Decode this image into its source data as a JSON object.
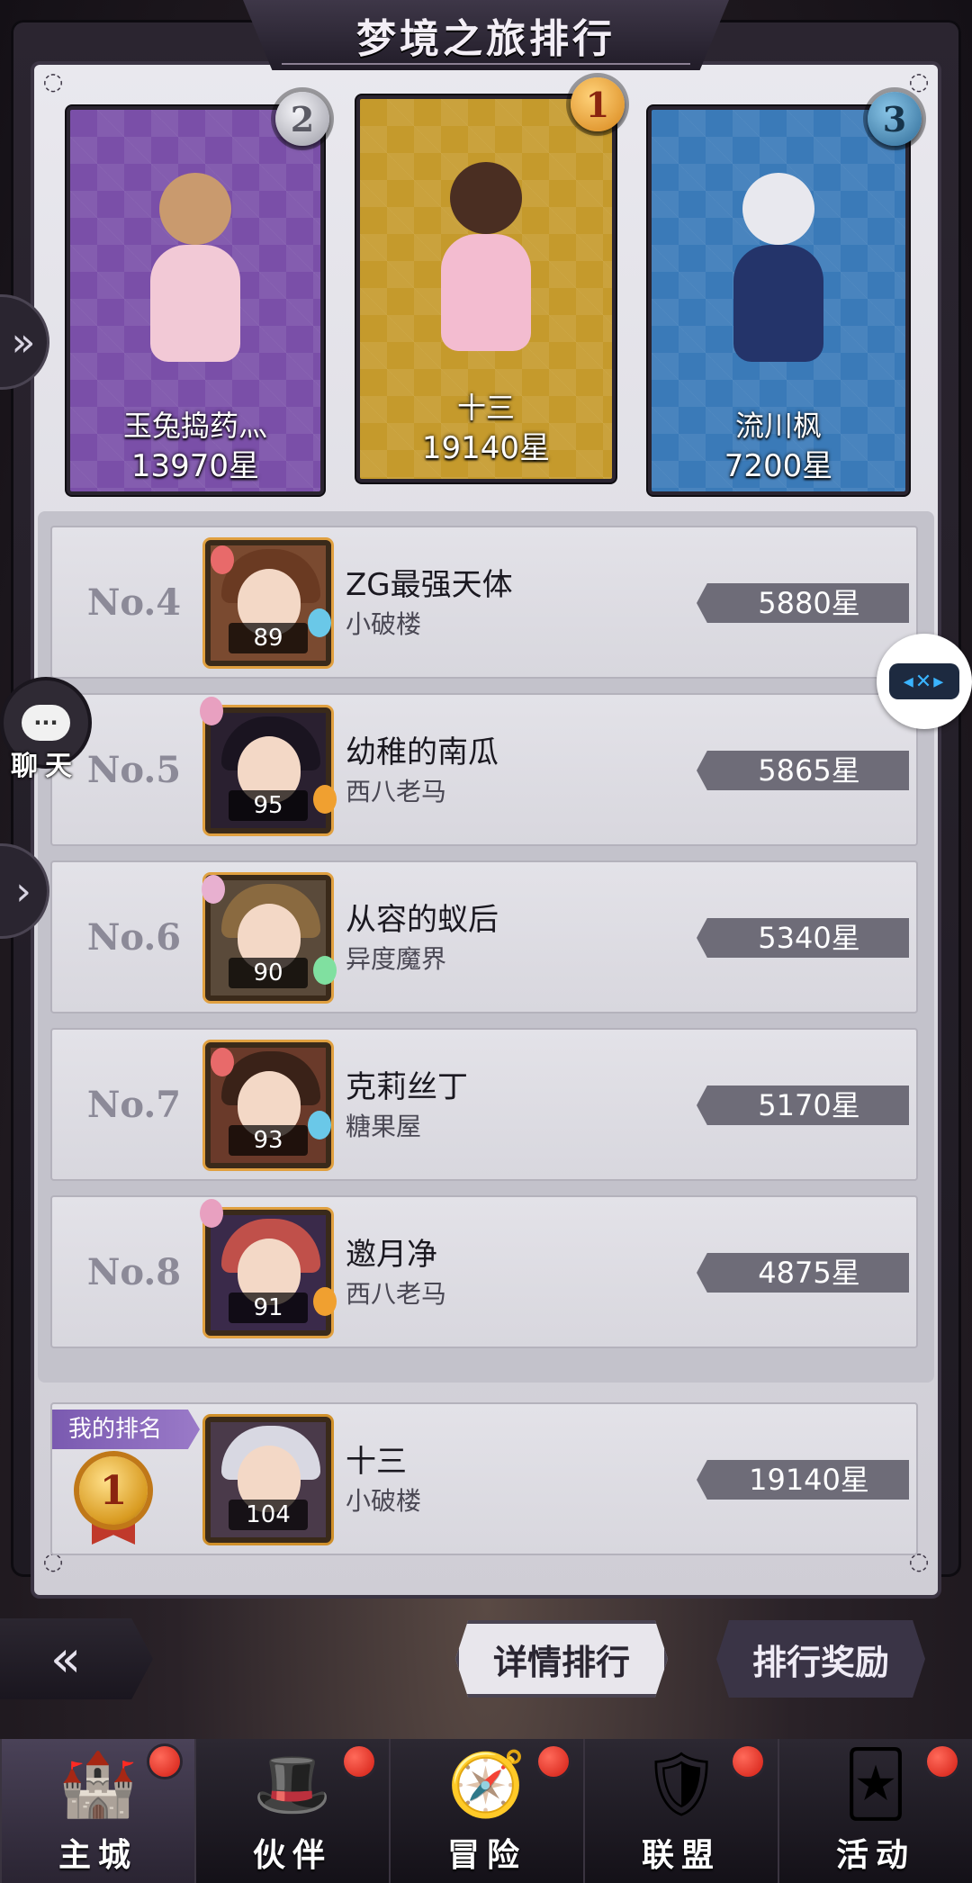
{
  "title": "梦境之旅排行",
  "podium": [
    {
      "rank": "2",
      "name": "玉兔捣药灬",
      "stars": "13970星",
      "bg": "#7a4fa8",
      "badge": "#c8c8d0"
    },
    {
      "rank": "1",
      "name": "十三",
      "stars": "19140星",
      "bg": "#c59a2c",
      "badge": "#e8a030"
    },
    {
      "rank": "3",
      "name": "流川枫",
      "stars": "7200星",
      "bg": "#3a7ab8",
      "badge": "#4a90c0"
    }
  ],
  "rankings": [
    {
      "no": "No.4",
      "level": "89",
      "name": "ZG最强天体",
      "guild": "小破楼",
      "stars": "5880星"
    },
    {
      "no": "No.5",
      "level": "95",
      "name": "幼稚的南瓜",
      "guild": "西八老马",
      "stars": "5865星"
    },
    {
      "no": "No.6",
      "level": "90",
      "name": "从容的蚁后",
      "guild": "异度魔界",
      "stars": "5340星"
    },
    {
      "no": "No.7",
      "level": "93",
      "name": "克莉丝丁",
      "guild": "糖果屋",
      "stars": "5170星"
    },
    {
      "no": "No.8",
      "level": "91",
      "name": "邀月净",
      "guild": "西八老马",
      "stars": "4875星"
    }
  ],
  "my_rank": {
    "tag": "我的排名",
    "rank": "1",
    "level": "104",
    "name": "十三",
    "guild": "小破楼",
    "stars": "19140星"
  },
  "side": {
    "chat_label": "聊天",
    "chat_icon_text": "···"
  },
  "buttons": {
    "details": "详情排行",
    "rewards": "排行奖励"
  },
  "nav": [
    {
      "label": "主城",
      "icon": "castle-icon",
      "glyph": "🏰",
      "active": true
    },
    {
      "label": "伙伴",
      "icon": "wizard-hat-icon",
      "glyph": "🎩",
      "active": false
    },
    {
      "label": "冒险",
      "icon": "compass-icon",
      "glyph": "🧭",
      "active": false
    },
    {
      "label": "联盟",
      "icon": "shield-icon",
      "glyph": "🛡",
      "active": false
    },
    {
      "label": "活动",
      "icon": "cards-icon",
      "glyph": "🃏",
      "active": false
    }
  ],
  "colors": {
    "accent_purple": "#7a5ab0",
    "star_pill": "#6e6c78",
    "notification_red": "#d21c12"
  }
}
